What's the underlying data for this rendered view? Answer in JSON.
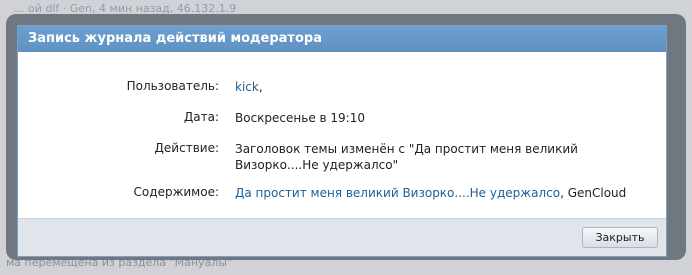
{
  "background": {
    "top_line": "... ой dlf · Gen, 4 мин назад, 46.132.1.9",
    "bottom_line": "ма перемещена из раздела \"Мануалы\""
  },
  "dialog": {
    "title": "Запись журнала действий модератора",
    "rows": {
      "user": {
        "label": "Пользователь:",
        "value": "kick",
        "suffix": ","
      },
      "date": {
        "label": "Дата:",
        "value": "Воскресенье в 19:10"
      },
      "action": {
        "label": "Действие:",
        "line1": "Заголовок темы изменён с \"Да простит меня великий",
        "line2": "Визорко....Не удержалсо\""
      },
      "content": {
        "label": "Содержимое:",
        "thread_link": "Да простит меня великий Визорко....Не удержалсо",
        "separator": ", ",
        "author": "GenCloud"
      }
    },
    "close_label": "Закрыть"
  },
  "colors": {
    "title_bar": "#6399cb",
    "link": "#1f5f93",
    "footer": "#dfe5eb"
  }
}
